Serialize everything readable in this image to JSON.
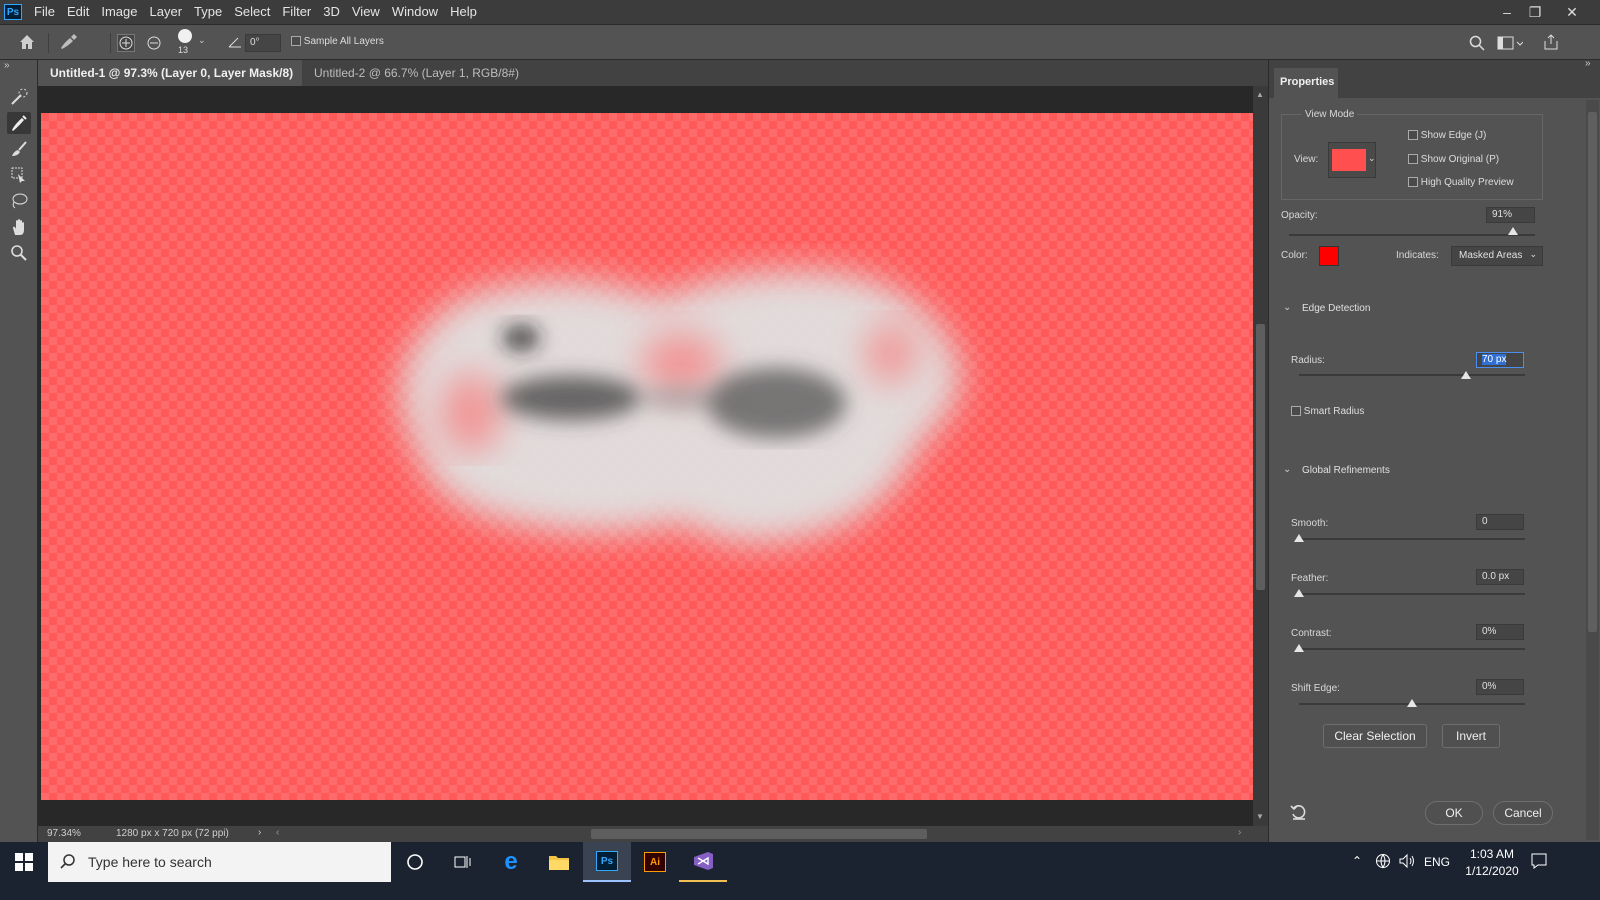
{
  "app": {
    "logo": "Ps",
    "menu": [
      "File",
      "Edit",
      "Image",
      "Layer",
      "Type",
      "Select",
      "Filter",
      "3D",
      "View",
      "Window",
      "Help"
    ]
  },
  "options_bar": {
    "brush_size": "13",
    "angle": "0°",
    "sample_all_layers_label": "Sample All Layers"
  },
  "tabs": [
    {
      "label": "Untitled-1 @ 97.3% (Layer 0, Layer Mask/8) *",
      "active": true
    },
    {
      "label": "Untitled-2 @ 66.7% (Layer 1, RGB/8#) *",
      "active": false
    }
  ],
  "status": {
    "zoom": "97.34%",
    "doc_info": "1280 px x 720 px (72 ppi)"
  },
  "properties": {
    "panel_title": "Properties",
    "view_mode": {
      "heading": "View Mode",
      "view_label": "View:",
      "show_edge": "Show Edge (J)",
      "show_original": "Show Original (P)",
      "high_quality": "High Quality Preview"
    },
    "opacity": {
      "label": "Opacity:",
      "value": "91%",
      "level": 0.91
    },
    "color": {
      "label": "Color:",
      "swatch": "#ff0000"
    },
    "indicates": {
      "label": "Indicates:",
      "value": "Masked Areas"
    },
    "edge_detection": {
      "heading": "Edge Detection",
      "radius_label": "Radius:",
      "radius_value": "70 px",
      "radius_level": 0.74,
      "smart_radius": "Smart Radius"
    },
    "global_refinements": {
      "heading": "Global Refinements",
      "smooth_label": "Smooth:",
      "smooth_value": "0",
      "smooth_level": 0.0,
      "feather_label": "Feather:",
      "feather_value": "0.0 px",
      "feather_level": 0.0,
      "contrast_label": "Contrast:",
      "contrast_value": "0%",
      "contrast_level": 0.0,
      "shift_label": "Shift Edge:",
      "shift_value": "0%",
      "shift_level": 0.5
    },
    "buttons": {
      "clear_selection": "Clear Selection",
      "invert": "Invert",
      "ok": "OK",
      "cancel": "Cancel"
    }
  },
  "taskbar": {
    "search_placeholder": "Type here to search",
    "lang": "ENG",
    "time": "1:03 AM",
    "date": "1/12/2020",
    "apps": [
      "cortana-icon",
      "task-view-icon",
      "edge-icon",
      "file-explorer-icon",
      "photoshop-icon",
      "illustrator-icon",
      "visual-studio-icon"
    ]
  }
}
